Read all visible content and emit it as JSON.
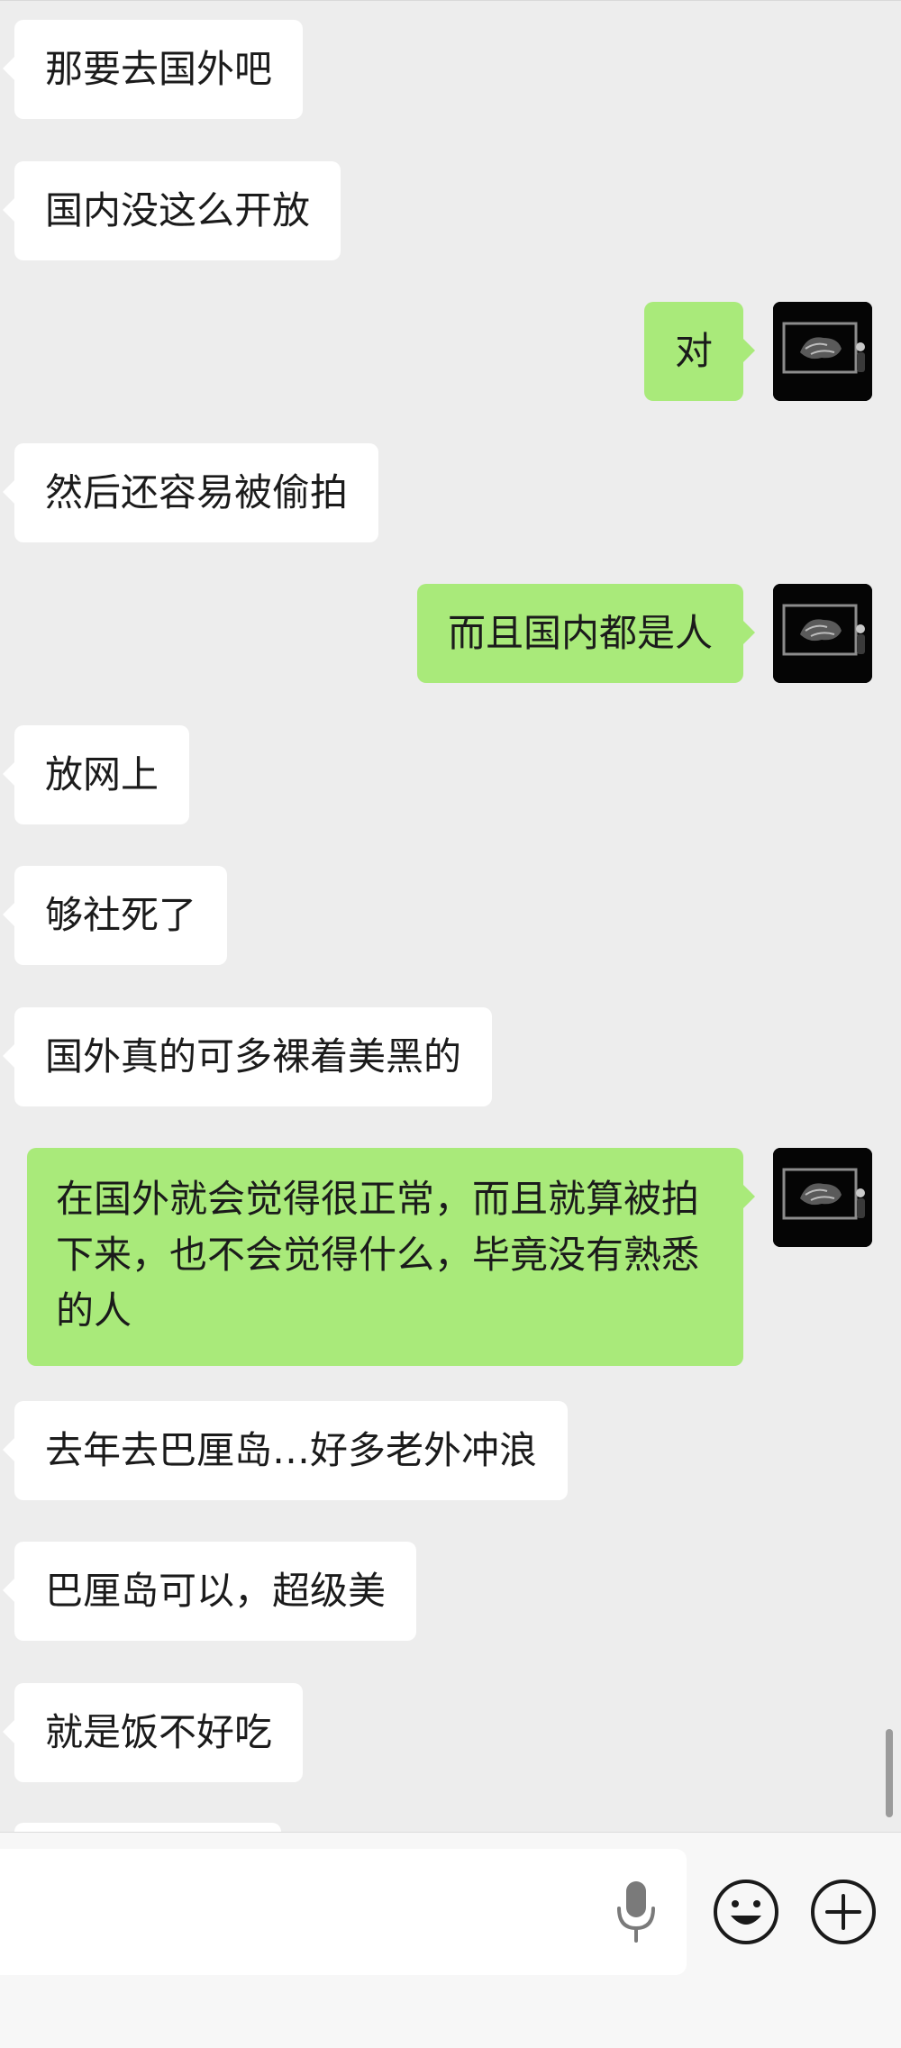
{
  "messages": [
    {
      "side": "left",
      "text": "那要去国外吧"
    },
    {
      "side": "left",
      "text": "国内没这么开放"
    },
    {
      "side": "right",
      "text": "对"
    },
    {
      "side": "left",
      "text": "然后还容易被偷拍"
    },
    {
      "side": "right",
      "text": "而且国内都是人"
    },
    {
      "side": "left",
      "text": "放网上"
    },
    {
      "side": "left",
      "text": "够社死了"
    },
    {
      "side": "left",
      "text": "国外真的可多裸着美黑的"
    },
    {
      "side": "right",
      "text": "在国外就会觉得很正常，而且就算被拍下来，也不会觉得什么，毕竟没有熟悉的人"
    },
    {
      "side": "left",
      "text": "去年去巴厘岛…好多老外冲浪"
    },
    {
      "side": "left",
      "text": "巴厘岛可以，超级美"
    },
    {
      "side": "left",
      "text": "就是饭不好吃"
    }
  ],
  "input_bar": {
    "value": "",
    "placeholder": "",
    "voice_icon": "microphone-icon",
    "emoji_icon": "smiley-face-icon",
    "more_icon": "plus-circle-icon"
  },
  "colors": {
    "background": "#ededed",
    "incoming_bubble": "#ffffff",
    "outgoing_bubble": "#a9ea7a",
    "text": "#1b1b1b",
    "icon": "#1a1a1a"
  }
}
